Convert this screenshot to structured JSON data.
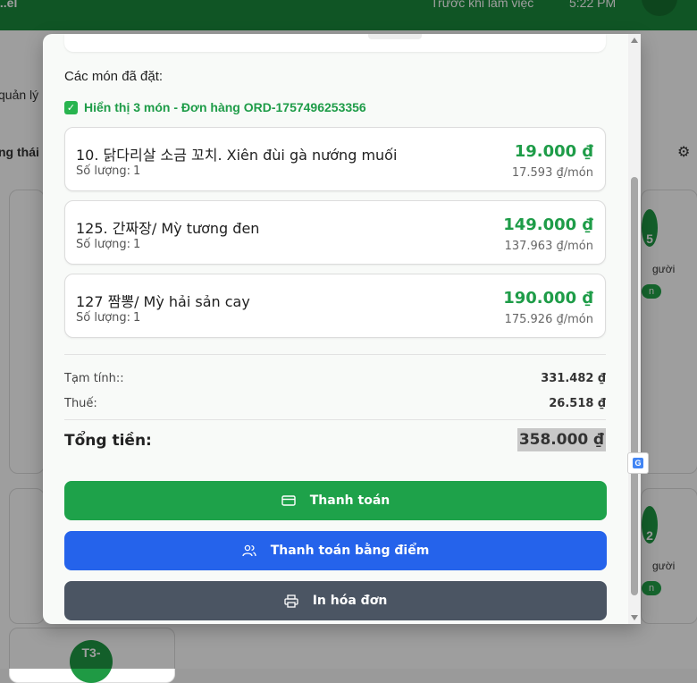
{
  "background": {
    "header_left": "...el",
    "header_right_label": "Trước khi làm việc",
    "header_time": "5:22 PM",
    "side_text_1": "quản lý",
    "side_text_2": "ng thái b",
    "card_badge_1": "5",
    "card_badge_2": "2",
    "card_badge_3": "T3-",
    "card_side_text": "gười",
    "card_pill": "n"
  },
  "modal": {
    "section_title": "Các món đã đặt:",
    "info_line": "Hiển thị 3 món - Đơn hàng ORD-1757496253356",
    "qty_label": "Số lượng:",
    "items": [
      {
        "name": "10. 닭다리살 소금 꼬치. Xiên đùi gà nướng muối",
        "quantity": "1",
        "price": "19.000 ₫",
        "unit_price": "17.593 ₫/món"
      },
      {
        "name": "125. 간짜장/ Mỳ tương đen",
        "quantity": "1",
        "price": "149.000 ₫",
        "unit_price": "137.963 ₫/món"
      },
      {
        "name": "127 짬뽕/ Mỳ hải sản cay",
        "quantity": "1",
        "price": "190.000 ₫",
        "unit_price": "175.926 ₫/món"
      }
    ],
    "summary": {
      "subtotal_label": "Tạm tính::",
      "subtotal_value": "331.482 ₫",
      "tax_label": "Thuế:",
      "tax_value": "26.518 ₫",
      "total_label": "Tổng tiền:",
      "total_value": "358.000 ₫"
    },
    "buttons": {
      "pay": "Thanh toán",
      "pay_points": "Thanh toán bằng điểm",
      "print": "In hóa đơn"
    }
  },
  "colors": {
    "accent_green": "#1ea24a",
    "price_green": "#1e9c48",
    "blue": "#2563eb",
    "gray_button": "#4b5563"
  },
  "icons": [
    "check-icon",
    "credit-card-icon",
    "users-icon",
    "printer-icon",
    "translate-icon"
  ]
}
